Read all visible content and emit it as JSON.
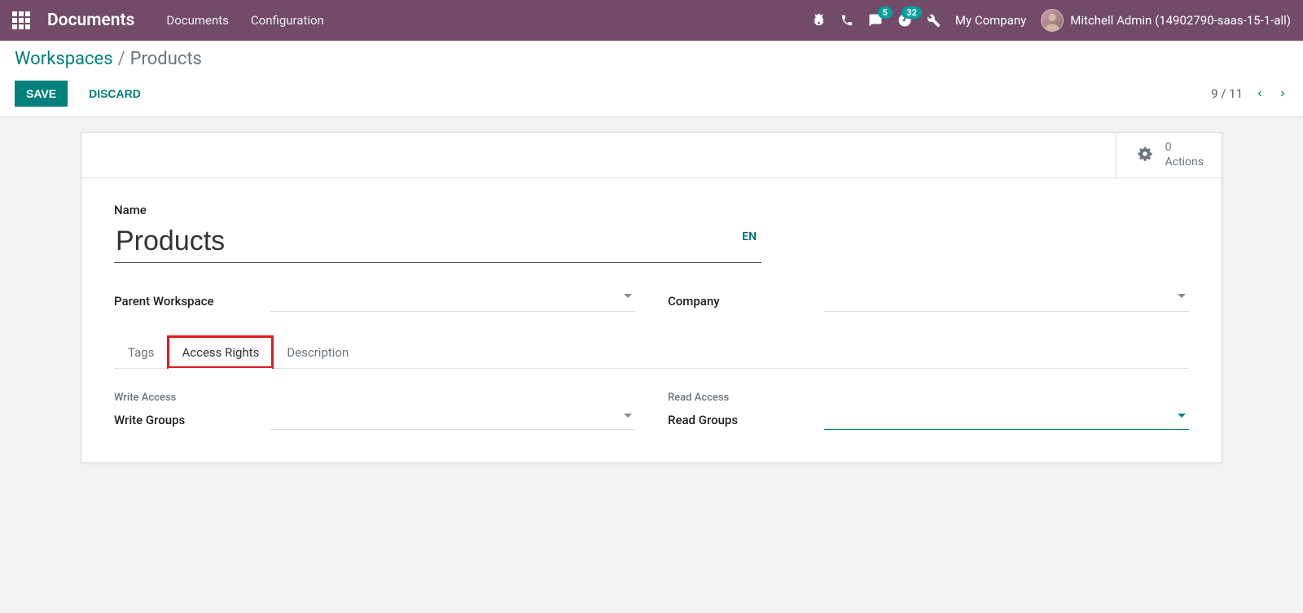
{
  "header": {
    "brand": "Documents",
    "nav": {
      "documents": "Documents",
      "configuration": "Configuration"
    },
    "badges": {
      "messages": "5",
      "activities": "32"
    },
    "company": "My Company",
    "user": "Mitchell Admin (14902790-saas-15-1-all)"
  },
  "breadcrumb": {
    "parent": "Workspaces",
    "current": "Products"
  },
  "actions": {
    "save": "SAVE",
    "discard": "DISCARD"
  },
  "pager": {
    "text": "9 / 11"
  },
  "stat_button": {
    "count": "0",
    "label": "Actions"
  },
  "form": {
    "name_label": "Name",
    "name_value": "Products",
    "lang_indicator": "EN",
    "parent_workspace_label": "Parent Workspace",
    "company_label": "Company"
  },
  "tabs": {
    "tags": "Tags",
    "access_rights": "Access Rights",
    "description": "Description"
  },
  "access": {
    "write_header": "Write Access",
    "write_groups_label": "Write Groups",
    "read_header": "Read Access",
    "read_groups_label": "Read Groups"
  }
}
